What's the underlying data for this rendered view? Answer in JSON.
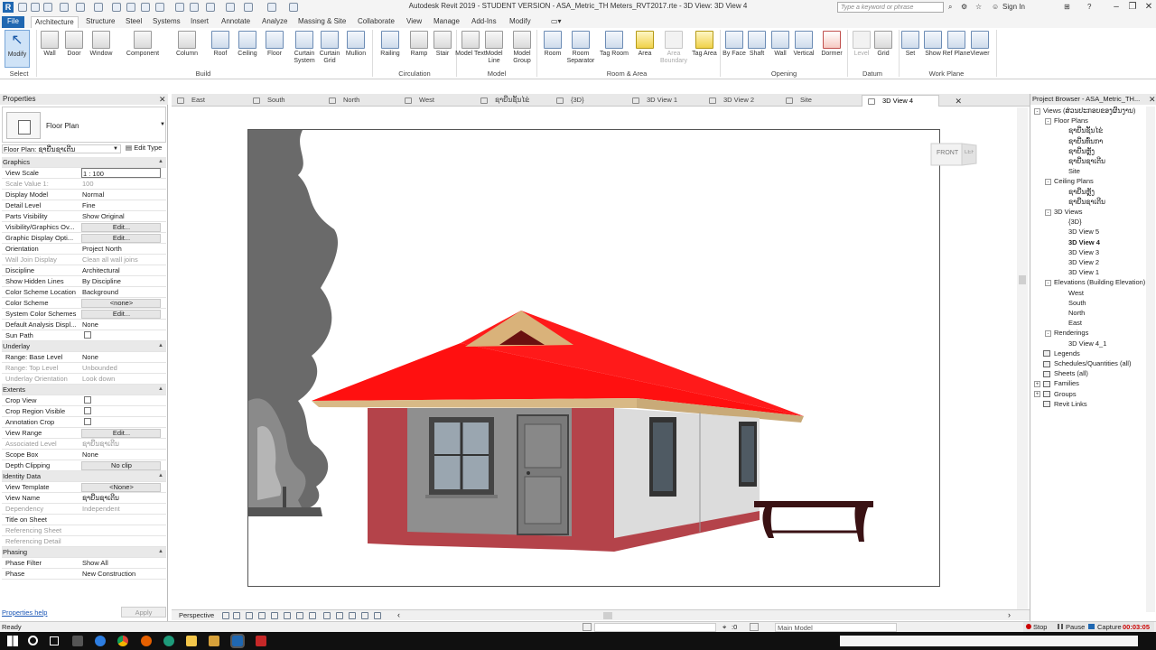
{
  "window": {
    "title": "Autodesk Revit 2019 - STUDENT VERSION - ASA_Metric_TH Meters_RVT2017.rte - 3D View: 3D View 4",
    "search_placeholder": "Type a keyword or phrase",
    "sign_in": "Sign In"
  },
  "ribbon_tabs": [
    "File",
    "Architecture",
    "Structure",
    "Steel",
    "Systems",
    "Insert",
    "Annotate",
    "Analyze",
    "Massing & Site",
    "Collaborate",
    "View",
    "Manage",
    "Add-Ins",
    "Modify"
  ],
  "active_tab": "Architecture",
  "ribbon": {
    "select": "Select",
    "modify": "Modify",
    "build": [
      "Wall",
      "Door",
      "Window",
      "Component",
      "Column",
      "Roof",
      "Ceiling",
      "Floor",
      "Curtain System",
      "Curtain Grid",
      "Mullion"
    ],
    "build_label": "Build",
    "circulation": [
      "Railing",
      "Ramp",
      "Stair"
    ],
    "circulation_label": "Circulation",
    "model": [
      "Model Text",
      "Model Line",
      "Model Group"
    ],
    "model_label": "Model",
    "room_area": [
      "Room",
      "Room Separator",
      "Tag Room",
      "Area",
      "Area Boundary",
      "Tag Area"
    ],
    "room_area_label": "Room & Area",
    "opening": [
      "By Face",
      "Shaft",
      "Wall",
      "Vertical",
      "Dormer"
    ],
    "opening_label": "Opening",
    "datum": [
      "Level",
      "Grid"
    ],
    "datum_label": "Datum",
    "work_plane": [
      "Set",
      "Show",
      "Ref Plane",
      "Viewer"
    ],
    "work_plane_label": "Work Plane"
  },
  "properties": {
    "title": "Properties",
    "type_name": "Floor Plan",
    "view_selector": "Floor Plan: ຊາຍີ່ນຊາເຕີນ",
    "edit_type": "Edit Type",
    "rows": [
      {
        "k": "Graphics",
        "sect": true
      },
      {
        "k": "View Scale",
        "v": "1 : 100",
        "input": true
      },
      {
        "k": "Scale Value    1:",
        "v": "100",
        "dis": true
      },
      {
        "k": "Display Model",
        "v": "Normal"
      },
      {
        "k": "Detail Level",
        "v": "Fine"
      },
      {
        "k": "Parts Visibility",
        "v": "Show Original"
      },
      {
        "k": "Visibility/Graphics Ov...",
        "v": "Edit...",
        "btn": true
      },
      {
        "k": "Graphic Display Opti...",
        "v": "Edit...",
        "btn": true
      },
      {
        "k": "Orientation",
        "v": "Project North"
      },
      {
        "k": "Wall Join Display",
        "v": "Clean all wall joins",
        "dis": true
      },
      {
        "k": "Discipline",
        "v": "Architectural"
      },
      {
        "k": "Show Hidden Lines",
        "v": "By Discipline"
      },
      {
        "k": "Color Scheme Location",
        "v": "Background"
      },
      {
        "k": "Color Scheme",
        "v": "<none>",
        "btn": true
      },
      {
        "k": "System Color Schemes",
        "v": "Edit...",
        "btn": true
      },
      {
        "k": "Default Analysis Displ...",
        "v": "None"
      },
      {
        "k": "Sun Path",
        "cb": true
      },
      {
        "k": "Underlay",
        "sect": true
      },
      {
        "k": "Range: Base Level",
        "v": "None"
      },
      {
        "k": "Range: Top Level",
        "v": "Unbounded",
        "dis": true
      },
      {
        "k": "Underlay Orientation",
        "v": "Look down",
        "dis": true
      },
      {
        "k": "Extents",
        "sect": true
      },
      {
        "k": "Crop View",
        "cb": true
      },
      {
        "k": "Crop Region Visible",
        "cb": true
      },
      {
        "k": "Annotation Crop",
        "cb": true
      },
      {
        "k": "View Range",
        "v": "Edit...",
        "btn": true
      },
      {
        "k": "Associated Level",
        "v": "ຊາຍີ່ນຊາເຕີນ",
        "dis": true
      },
      {
        "k": "Scope Box",
        "v": "None"
      },
      {
        "k": "Depth Clipping",
        "v": "No clip",
        "btn": true
      },
      {
        "k": "Identity Data",
        "sect": true
      },
      {
        "k": "View Template",
        "v": "<None>",
        "btn": true
      },
      {
        "k": "View Name",
        "v": "ຊາຍີ່ນຊາເຕີນ"
      },
      {
        "k": "Dependency",
        "v": "Independent",
        "dis": true
      },
      {
        "k": "Title on Sheet",
        "v": ""
      },
      {
        "k": "Referencing Sheet",
        "v": "",
        "dis": true
      },
      {
        "k": "Referencing Detail",
        "v": "",
        "dis": true
      },
      {
        "k": "Phasing",
        "sect": true
      },
      {
        "k": "Phase Filter",
        "v": "Show All"
      },
      {
        "k": "Phase",
        "v": "New Construction"
      }
    ],
    "help": "Properties help",
    "apply": "Apply"
  },
  "view_tabs": [
    "East",
    "South",
    "North",
    "West",
    "ຊາຍີ່ນຊັ້ນໄຂ່",
    "{3D}",
    "3D View 1",
    "3D View 2",
    "Site",
    "3D View 4"
  ],
  "active_view_tab": "3D View 4",
  "view_control": {
    "scale": "Perspective"
  },
  "viewcube": {
    "front": "FRONT",
    "side": "LEFT"
  },
  "browser": {
    "title": "Project Browser - ASA_Metric_TH...",
    "items": [
      {
        "label": "Views (ສ່ວນປະກອບຂອງຜົນງານ)",
        "lvl": 0,
        "tog": "-"
      },
      {
        "label": "Floor Plans",
        "lvl": 1,
        "tog": "-"
      },
      {
        "label": "ຊາຍີ່ນຊັ້ນໄຂ່",
        "lvl": 2
      },
      {
        "label": "ຊາຍີ່ນທົ່ນກາ",
        "lvl": 2
      },
      {
        "label": "ຊາຍີ່ນຫຼັງ",
        "lvl": 2
      },
      {
        "label": "ຊາຍີ່ນຊາເຕີນ",
        "lvl": 2
      },
      {
        "label": "Site",
        "lvl": 2
      },
      {
        "label": "Ceiling Plans",
        "lvl": 1,
        "tog": "-"
      },
      {
        "label": "ຊາຍີ່ນຫຼັງ",
        "lvl": 2
      },
      {
        "label": "ຊາຍີ່ນຊາເຕີນ",
        "lvl": 2
      },
      {
        "label": "3D Views",
        "lvl": 1,
        "tog": "-"
      },
      {
        "label": "{3D}",
        "lvl": 2
      },
      {
        "label": "3D View 5",
        "lvl": 2
      },
      {
        "label": "3D View 4",
        "lvl": 2,
        "bold": true
      },
      {
        "label": "3D View 3",
        "lvl": 2
      },
      {
        "label": "3D View 2",
        "lvl": 2
      },
      {
        "label": "3D View 1",
        "lvl": 2
      },
      {
        "label": "Elevations (Building Elevation)",
        "lvl": 1,
        "tog": "-"
      },
      {
        "label": "West",
        "lvl": 2
      },
      {
        "label": "South",
        "lvl": 2
      },
      {
        "label": "North",
        "lvl": 2
      },
      {
        "label": "East",
        "lvl": 2
      },
      {
        "label": "Renderings",
        "lvl": 1,
        "tog": "-"
      },
      {
        "label": "3D View 4_1",
        "lvl": 2
      },
      {
        "label": "Legends",
        "lvl": 0,
        "ico": true
      },
      {
        "label": "Schedules/Quantities (all)",
        "lvl": 0,
        "ico": true
      },
      {
        "label": "Sheets (all)",
        "lvl": 0,
        "ico": true
      },
      {
        "label": "Families",
        "lvl": 0,
        "tog": "+",
        "ico": true
      },
      {
        "label": "Groups",
        "lvl": 0,
        "tog": "+",
        "ico": true
      },
      {
        "label": "Revit Links",
        "lvl": 0,
        "ico": true
      }
    ]
  },
  "status": {
    "ready": "Ready",
    "workset_value": ":0",
    "model": "Main Model",
    "stop": "Stop",
    "pause": "Pause",
    "capture": "Capture",
    "timer": "00:03:05"
  },
  "colors": {
    "roof": "#ff1010",
    "brick": "#b4434a",
    "wall": "#d8d8d8",
    "accent": "#1f67b1"
  }
}
